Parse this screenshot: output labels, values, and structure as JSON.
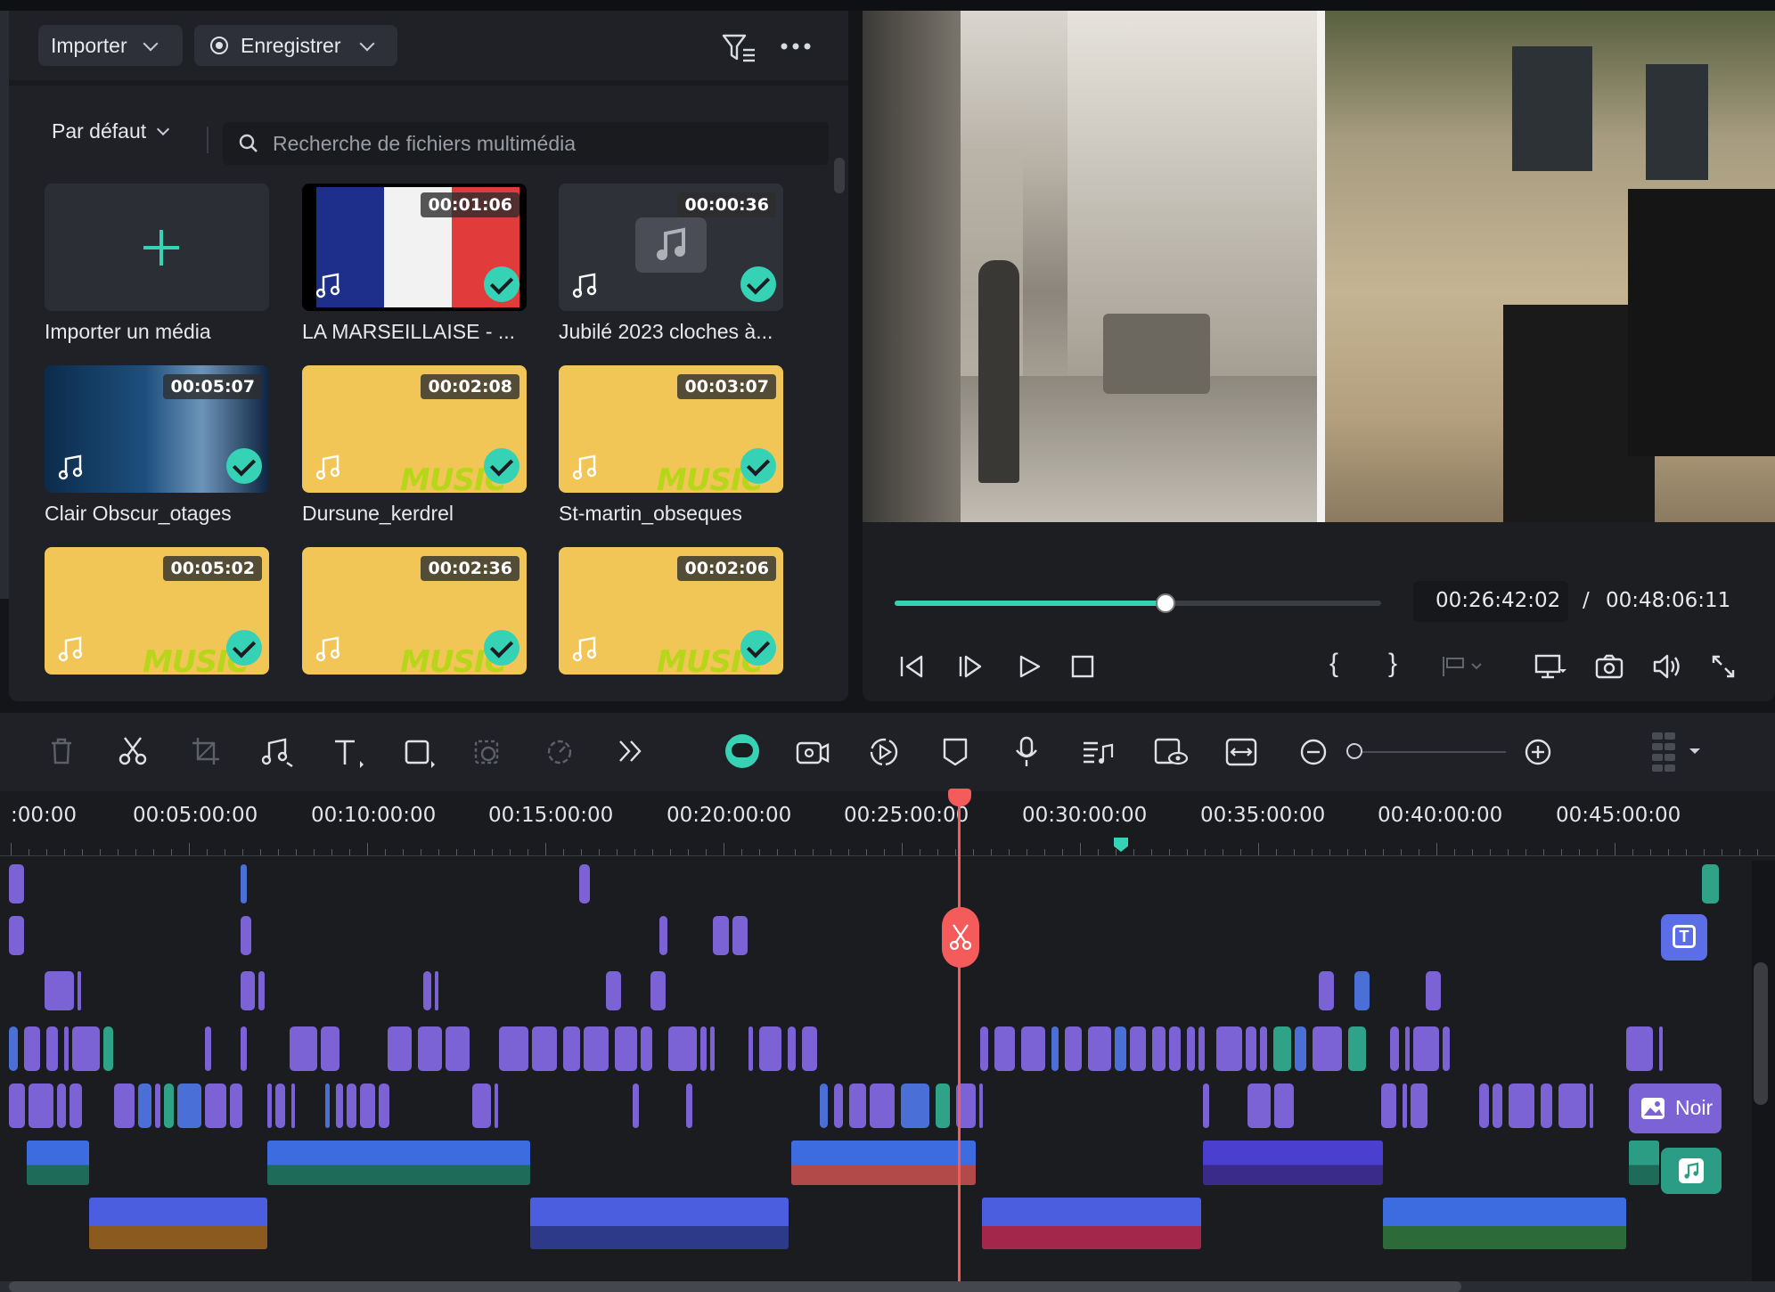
{
  "toolbar_top": {
    "import_label": "Importer",
    "record_label": "Enregistrer",
    "filter_icon": "filter-icon",
    "more_icon": "more-icon"
  },
  "library": {
    "sort_label": "Par défaut",
    "search_placeholder": "Recherche de fichiers multimédia",
    "import_tile_label": "Importer un média",
    "items": [
      {
        "label": "LA MARSEILLAISE - ...",
        "duration": "00:01:06"
      },
      {
        "label": "Jubilé 2023 cloches à...",
        "duration": "00:00:36"
      },
      {
        "label": "Clair Obscur_otages",
        "duration": "00:05:07"
      },
      {
        "label": "Dursune_kerdrel",
        "duration": "00:02:08"
      },
      {
        "label": "St-martin_obseques",
        "duration": "00:03:07"
      },
      {
        "label": "",
        "duration": "00:05:02"
      },
      {
        "label": "",
        "duration": "00:02:36"
      },
      {
        "label": "",
        "duration": "00:02:06"
      }
    ],
    "music_tag": "MUSIC"
  },
  "preview": {
    "current_time": "00:26:42:02",
    "separator": "/",
    "total_time": "00:48:06:11",
    "progress": 0.556,
    "brace_open": "{",
    "brace_close": "}"
  },
  "timeline": {
    "ruler_labels": [
      ":00:00",
      "00:05:00:00",
      "00:10:00:00",
      "00:15:00:00",
      "00:20:00:00",
      "00:25:00:00",
      "00:30:00:00",
      "00:35:00:00",
      "00:40:00:00",
      "00:45:00:00"
    ],
    "noir_label": "Noir",
    "zoom_level": 0.0
  },
  "colors": {
    "accent": "#35d2b6",
    "playhead": "#f45b5b",
    "clip": "#7b63d6",
    "music_bg": "#f2c656"
  }
}
